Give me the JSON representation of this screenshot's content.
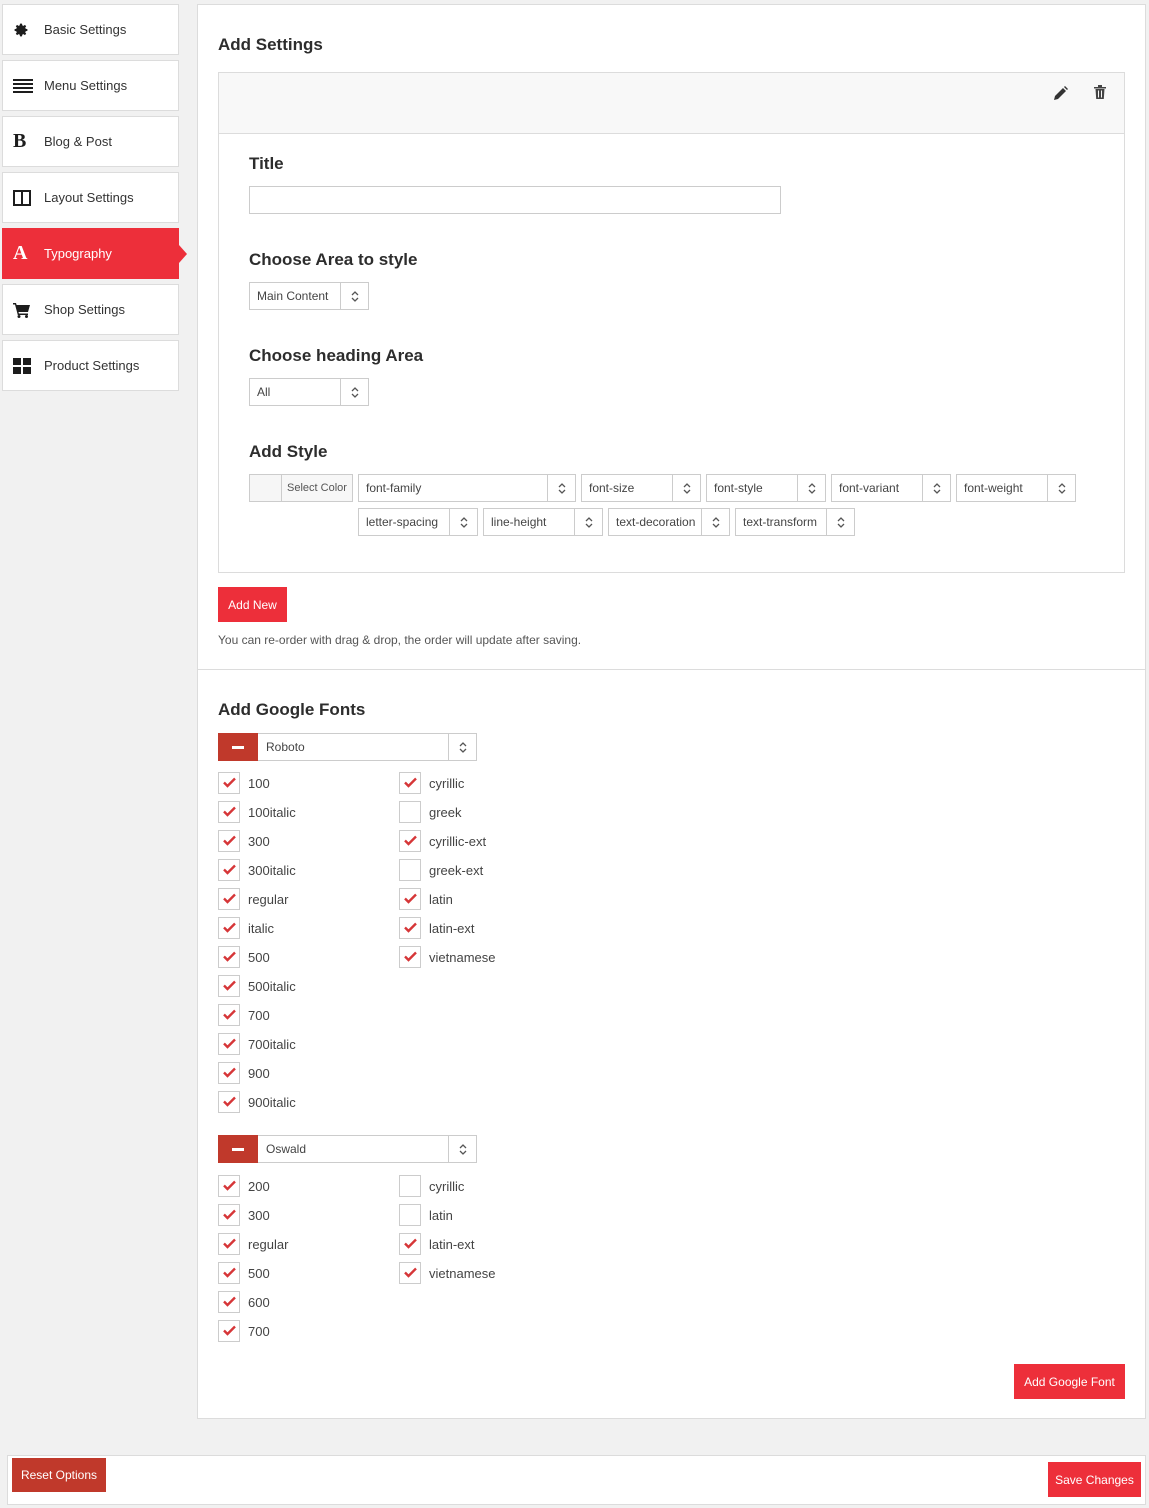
{
  "sidebar": {
    "items": [
      {
        "label": "Basic Settings",
        "icon": "gear-icon"
      },
      {
        "label": "Menu Settings",
        "icon": "menu-lines-icon"
      },
      {
        "label": "Blog & Post",
        "icon": "bold-b-icon"
      },
      {
        "label": "Layout Settings",
        "icon": "columns-icon"
      },
      {
        "label": "Typography",
        "icon": "letter-a-icon",
        "active": true
      },
      {
        "label": "Shop Settings",
        "icon": "cart-icon"
      },
      {
        "label": "Product Settings",
        "icon": "grid-icon"
      }
    ]
  },
  "add_settings": {
    "title": "Add Settings",
    "title_label": "Title",
    "title_value": "",
    "area_label": "Choose Area to style",
    "area_value": "Main Content",
    "heading_label": "Choose heading Area",
    "heading_value": "All",
    "style_label": "Add Style",
    "color_button": "Select Color",
    "style_selects": [
      "font-family",
      "font-size",
      "font-style",
      "font-variant",
      "font-weight",
      "letter-spacing",
      "line-height",
      "text-decoration",
      "text-transform"
    ],
    "add_new_label": "Add New",
    "note": "You can re-order with drag & drop, the order will update after saving."
  },
  "google_fonts": {
    "title": "Add Google Fonts",
    "fonts": [
      {
        "name": "Roboto",
        "variants": [
          {
            "label": "100",
            "checked": true
          },
          {
            "label": "100italic",
            "checked": true
          },
          {
            "label": "300",
            "checked": true
          },
          {
            "label": "300italic",
            "checked": true
          },
          {
            "label": "regular",
            "checked": true
          },
          {
            "label": "italic",
            "checked": true
          },
          {
            "label": "500",
            "checked": true
          },
          {
            "label": "500italic",
            "checked": true
          },
          {
            "label": "700",
            "checked": true
          },
          {
            "label": "700italic",
            "checked": true
          },
          {
            "label": "900",
            "checked": true
          },
          {
            "label": "900italic",
            "checked": true
          }
        ],
        "subsets": [
          {
            "label": "cyrillic",
            "checked": true
          },
          {
            "label": "greek",
            "checked": false
          },
          {
            "label": "cyrillic-ext",
            "checked": true
          },
          {
            "label": "greek-ext",
            "checked": false
          },
          {
            "label": "latin",
            "checked": true
          },
          {
            "label": "latin-ext",
            "checked": true
          },
          {
            "label": "vietnamese",
            "checked": true
          }
        ]
      },
      {
        "name": "Oswald",
        "variants": [
          {
            "label": "200",
            "checked": true
          },
          {
            "label": "300",
            "checked": true
          },
          {
            "label": "regular",
            "checked": true
          },
          {
            "label": "500",
            "checked": true
          },
          {
            "label": "600",
            "checked": true
          },
          {
            "label": "700",
            "checked": true
          }
        ],
        "subsets": [
          {
            "label": "cyrillic",
            "checked": false
          },
          {
            "label": "latin",
            "checked": false
          },
          {
            "label": "latin-ext",
            "checked": true
          },
          {
            "label": "vietnamese",
            "checked": true
          }
        ]
      }
    ],
    "add_font_label": "Add Google Font"
  },
  "footer": {
    "reset_label": "Reset Options",
    "save_label": "Save Changes"
  },
  "colors": {
    "accent": "#ed2f3a",
    "dark_accent": "#c0392b",
    "check": "#d63638"
  }
}
